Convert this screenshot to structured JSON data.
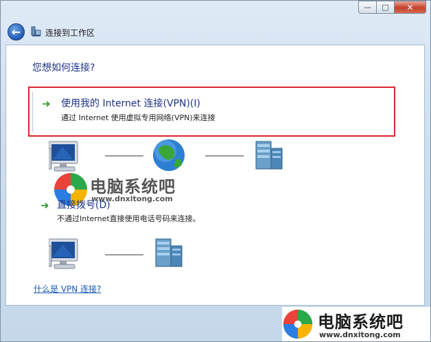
{
  "window": {
    "title": "连接到工作区",
    "controls": {
      "minimize": "—",
      "maximize": "□",
      "close": "✕"
    }
  },
  "main": {
    "heading": "您想如何连接?",
    "options": [
      {
        "title": "使用我的 Internet 连接(VPN)(I)",
        "desc": "通过 Internet 使用虚拟专用网络(VPN)来连接",
        "highlighted": true
      },
      {
        "title": "直接拨号(D)",
        "desc": "不通过Internet直接使用电话号码来连接。"
      }
    ],
    "help_link": "什么是 VPN 连接?"
  },
  "watermark": {
    "brand": "电脑系统吧",
    "url": "www.dnxitong.com"
  },
  "colors": {
    "highlight_border": "#d9262d",
    "heading": "#1e3287",
    "link": "#1a58b8",
    "arrow": "#2a9c2a"
  },
  "icons": [
    "back-arrow-icon",
    "network-folder-icon",
    "computer-icon",
    "globe-icon",
    "server-icon",
    "windows-logo-icon"
  ]
}
